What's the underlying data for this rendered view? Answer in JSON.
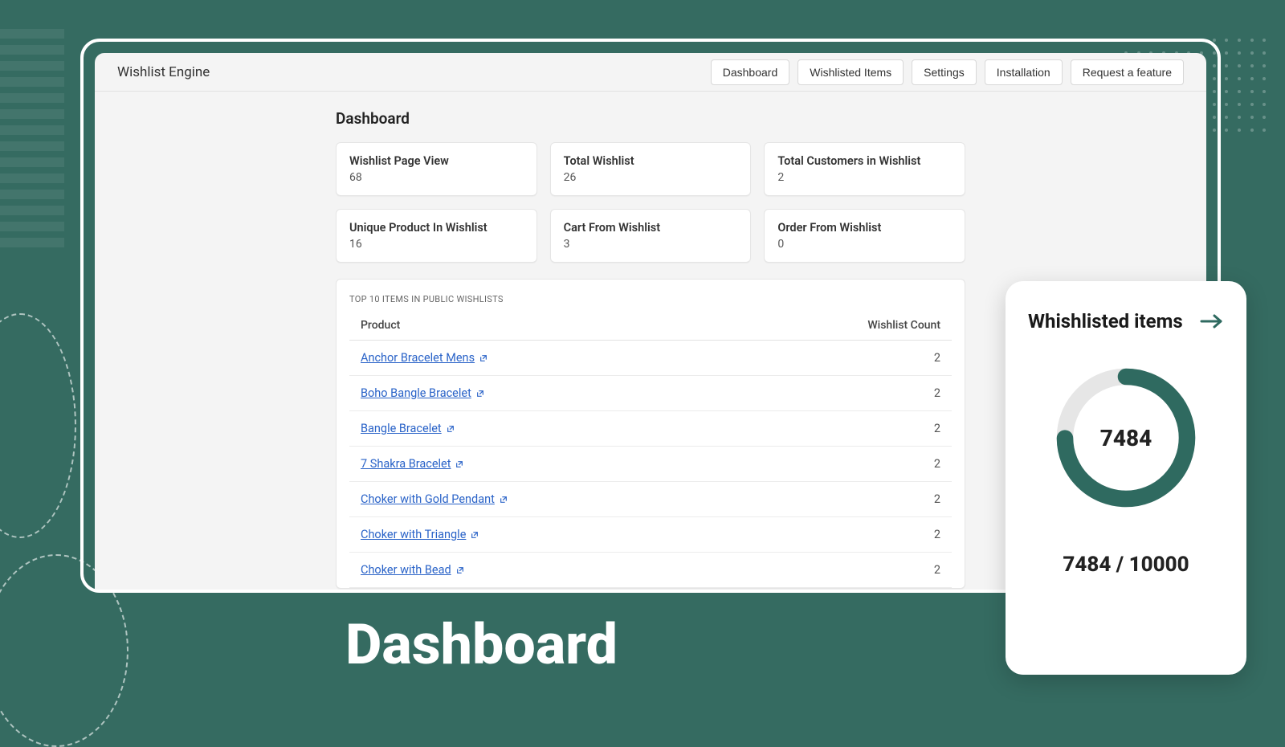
{
  "app_title": "Wishlist Engine",
  "nav": [
    "Dashboard",
    "Wishlisted Items",
    "Settings",
    "Installation",
    "Request a feature"
  ],
  "page_heading": "Dashboard",
  "stats": [
    {
      "label": "Wishlist Page View",
      "value": "68"
    },
    {
      "label": "Total Wishlist",
      "value": "26"
    },
    {
      "label": "Total Customers in Wishlist",
      "value": "2"
    },
    {
      "label": "Unique Product In Wishlist",
      "value": "16"
    },
    {
      "label": "Cart From Wishlist",
      "value": "3"
    },
    {
      "label": "Order From Wishlist",
      "value": "0"
    }
  ],
  "table": {
    "title": "TOP 10 ITEMS IN PUBLIC WISHLISTS",
    "col_product": "Product",
    "col_count": "Wishlist Count",
    "rows": [
      {
        "name": "Anchor Bracelet Mens",
        "count": "2"
      },
      {
        "name": "Boho Bangle Bracelet",
        "count": "2"
      },
      {
        "name": "Bangle Bracelet",
        "count": "2"
      },
      {
        "name": "7 Shakra Bracelet",
        "count": "2"
      },
      {
        "name": "Choker with Gold Pendant",
        "count": "2"
      },
      {
        "name": "Choker with Triangle",
        "count": "2"
      },
      {
        "name": "Choker with Bead",
        "count": "2"
      }
    ]
  },
  "float": {
    "title": "Whishlisted items",
    "center": "7484",
    "ratio": "7484 / 10000"
  },
  "hero": "Dashboard",
  "chart_data": {
    "type": "pie",
    "title": "Whishlisted items",
    "values": [
      7484,
      2516
    ],
    "total": 10000,
    "percent": 74.84,
    "center_label": "7484",
    "ratio_label": "7484 / 10000",
    "colors": {
      "filled": "#2f6a60",
      "track": "#e6e6e6"
    }
  }
}
